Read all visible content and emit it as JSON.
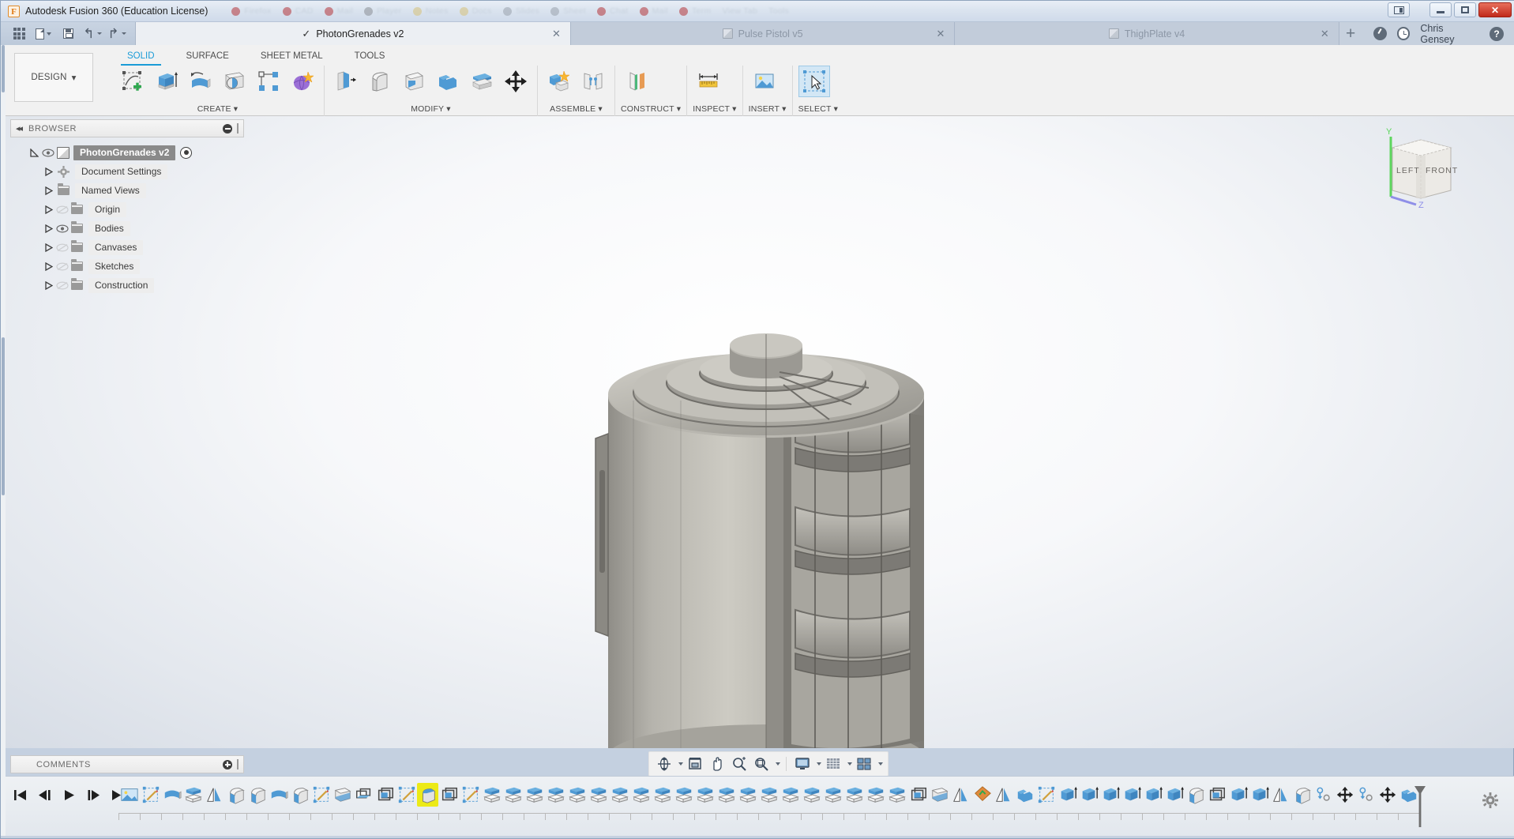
{
  "window": {
    "title": "Autodesk Fusion 360 (Education License)",
    "logo_letter": "F",
    "minimize_icon": "minimize-icon",
    "maximize_icon": "maximize-icon",
    "close_icon": "close-icon",
    "close_label": "✕"
  },
  "quick_access": {
    "show_data_panel": "grid-icon",
    "file": "file-icon",
    "save": "save-icon",
    "undo": "undo-icon",
    "redo": "redo-icon"
  },
  "doc_tabs": [
    {
      "label": "PhotonGrenades v2",
      "active": true,
      "checkmark": "✓",
      "close": "✕"
    },
    {
      "label": "Pulse Pistol v5",
      "active": false,
      "icon": "cube-icon",
      "close": "✕"
    },
    {
      "label": "ThighPlate v4",
      "active": false,
      "icon": "cube-icon",
      "close": "✕"
    }
  ],
  "tab_add_label": "+",
  "account": {
    "job_status_icon": "job-status-icon",
    "recent_icon": "clock-icon",
    "user_name": "Chris Gensey",
    "help_icon": "help-icon",
    "help_label": "?"
  },
  "ribbon": {
    "workspace_label": "DESIGN",
    "workspace_caret": "▾",
    "tabs": [
      {
        "label": "SOLID",
        "active": true
      },
      {
        "label": "SURFACE",
        "active": false
      },
      {
        "label": "SHEET METAL",
        "active": false
      },
      {
        "label": "TOOLS",
        "active": false
      }
    ],
    "groups": [
      {
        "label": "CREATE",
        "caret": "▾",
        "buttons": [
          {
            "name": "create-sketch-button"
          },
          {
            "name": "extrude-button"
          },
          {
            "name": "revolve-button"
          },
          {
            "name": "sphere-button"
          },
          {
            "name": "pattern-button"
          },
          {
            "name": "form-button"
          }
        ]
      },
      {
        "label": "MODIFY",
        "caret": "▾",
        "buttons": [
          {
            "name": "press-pull-button"
          },
          {
            "name": "fillet-button"
          },
          {
            "name": "shell-button"
          },
          {
            "name": "combine-button"
          },
          {
            "name": "offset-face-button"
          },
          {
            "name": "move-copy-button"
          }
        ]
      },
      {
        "label": "ASSEMBLE",
        "caret": "▾",
        "buttons": [
          {
            "name": "new-component-button"
          },
          {
            "name": "joint-button"
          }
        ]
      },
      {
        "label": "CONSTRUCT",
        "caret": "▾",
        "buttons": [
          {
            "name": "offset-plane-button"
          }
        ]
      },
      {
        "label": "INSPECT",
        "caret": "▾",
        "buttons": [
          {
            "name": "measure-button"
          }
        ]
      },
      {
        "label": "INSERT",
        "caret": "▾",
        "buttons": [
          {
            "name": "insert-canvas-button"
          }
        ]
      },
      {
        "label": "SELECT",
        "caret": "▾",
        "buttons": [
          {
            "name": "select-button",
            "selected": true
          }
        ]
      }
    ]
  },
  "browser": {
    "panel_title": "BROWSER",
    "collapse_icon": "◂◂",
    "collapse_all_icon": "minus-circle-icon",
    "root": {
      "label": "PhotonGrenades v2",
      "selected": true,
      "visible": true,
      "expanded": true,
      "activate_icon": "radio-dot-icon"
    },
    "items": [
      {
        "label": "Document Settings",
        "icon": "gear-icon",
        "eye": "none",
        "expanded": false
      },
      {
        "label": "Named Views",
        "icon": "folder-icon",
        "eye": "none",
        "expanded": false
      },
      {
        "label": "Origin",
        "icon": "folder-icon",
        "eye": "hidden",
        "expanded": false
      },
      {
        "label": "Bodies",
        "icon": "folder-icon",
        "eye": "visible",
        "expanded": false
      },
      {
        "label": "Canvases",
        "icon": "folder-icon",
        "eye": "hidden",
        "expanded": false
      },
      {
        "label": "Sketches",
        "icon": "folder-icon",
        "eye": "hidden",
        "expanded": false
      },
      {
        "label": "Construction",
        "icon": "folder-icon",
        "eye": "hidden",
        "expanded": false
      }
    ]
  },
  "viewcube": {
    "face_front": "FRONT",
    "face_left": "LEFT",
    "axis_y": "Y",
    "axis_z": "Z",
    "axis_y_color": "#5ed65e",
    "axis_z_color": "#8f8fe8"
  },
  "comments": {
    "panel_title": "COMMENTS",
    "add_icon": "plus-circle-icon"
  },
  "navbar": {
    "buttons": [
      {
        "name": "orbit-button",
        "caret": true
      },
      {
        "name": "look-at-button",
        "caret": false
      },
      {
        "name": "pan-button",
        "caret": false
      },
      {
        "name": "zoom-button",
        "caret": false
      },
      {
        "name": "fit-button",
        "caret": true
      },
      {
        "name": "display-settings-button",
        "caret": true
      },
      {
        "name": "grid-snaps-button",
        "caret": true
      },
      {
        "name": "viewports-button",
        "caret": true
      }
    ]
  },
  "timeline": {
    "playback": [
      {
        "name": "go-to-beginning-button",
        "glyph": "⏮"
      },
      {
        "name": "step-back-button",
        "glyph": "◀|"
      },
      {
        "name": "play-button",
        "glyph": "▶"
      },
      {
        "name": "step-forward-button",
        "glyph": "|▶"
      },
      {
        "name": "go-to-end-button",
        "glyph": "⏭"
      }
    ],
    "feature_count": 57,
    "highlighted_index": 14,
    "features": [
      "canvas",
      "sketch",
      "revolve",
      "extrude",
      "mirror",
      "revolve-cut",
      "revolve-cut",
      "revolve",
      "revolve-cut",
      "sketch",
      "shell",
      "pattern-rect",
      "pattern-circ",
      "sketch",
      "revolve-hl",
      "pattern-circ",
      "sketch",
      "extrude",
      "extrude",
      "extrude",
      "extrude",
      "extrude",
      "extrude",
      "extrude",
      "extrude",
      "extrude",
      "extrude",
      "extrude",
      "extrude",
      "extrude",
      "extrude",
      "extrude",
      "extrude",
      "extrude",
      "extrude",
      "extrude",
      "extrude",
      "pattern-circ",
      "shell",
      "mirror",
      "appearance",
      "mirror",
      "combine",
      "sketch",
      "extrude-h",
      "extrude-h",
      "extrude-h",
      "extrude-h",
      "extrude-h",
      "extrude-h",
      "revolve-cut",
      "pattern-circ",
      "extrude-h",
      "extrude-h",
      "mirror",
      "revolve-cut",
      "joint",
      "move",
      "joint",
      "move",
      "combine"
    ],
    "settings_icon": "gear-icon"
  }
}
